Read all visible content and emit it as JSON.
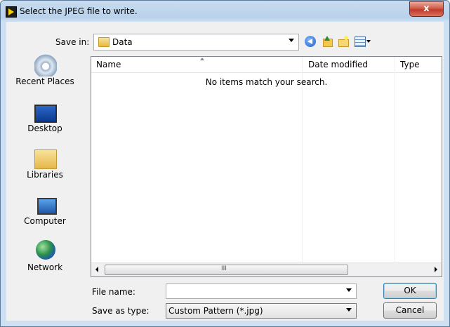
{
  "window": {
    "title": "Select the JPEG file to write.",
    "close_label": "x"
  },
  "toolbar": {
    "save_in_label": "Save in:",
    "save_in_value": "Data"
  },
  "places": [
    {
      "label": "Recent Places",
      "icon": "recent-places-icon"
    },
    {
      "label": "Desktop",
      "icon": "desktop-icon"
    },
    {
      "label": "Libraries",
      "icon": "libraries-icon"
    },
    {
      "label": "Computer",
      "icon": "computer-icon"
    },
    {
      "label": "Network",
      "icon": "network-icon"
    }
  ],
  "file_list": {
    "columns": [
      "Name",
      "Date modified",
      "Type"
    ],
    "empty_message": "No items match your search.",
    "scroll_grip": "III"
  },
  "fields": {
    "file_name_label": "File name:",
    "file_name_value": "",
    "save_as_type_label": "Save as type:",
    "save_as_type_value": "Custom Pattern (*.jpg)"
  },
  "buttons": {
    "ok": "OK",
    "cancel": "Cancel"
  }
}
